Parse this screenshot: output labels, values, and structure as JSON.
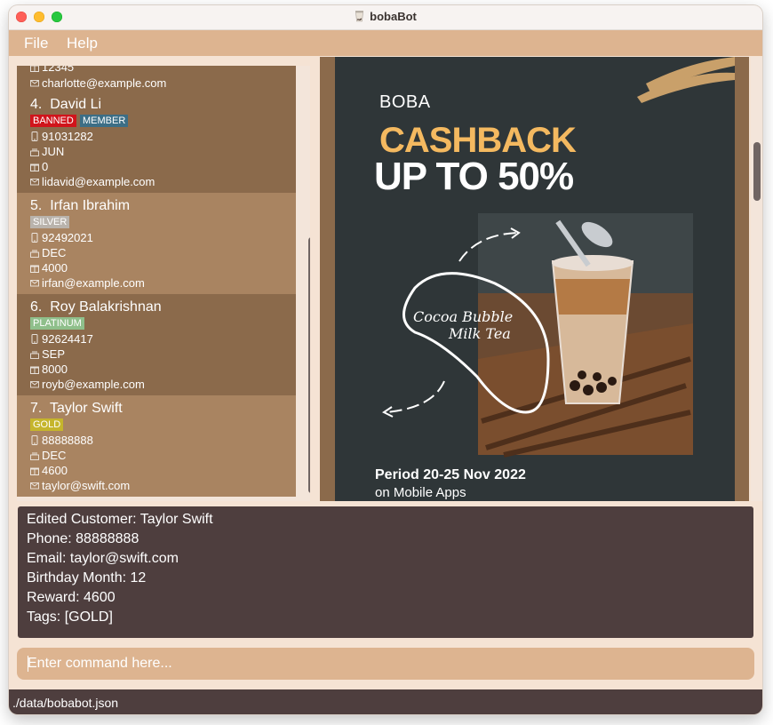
{
  "window": {
    "title": "bobaBot"
  },
  "menu": {
    "file": "File",
    "help": "Help"
  },
  "customers": [
    {
      "index": "",
      "name": "",
      "tags": [],
      "phone": "12345",
      "birthday": "",
      "reward": "",
      "email": "charlotte@example.com"
    },
    {
      "index": "4.",
      "name": "David Li",
      "tags": [
        {
          "label": "BANNED",
          "color": "#d0141b"
        },
        {
          "label": "MEMBER",
          "color": "#3c6e86"
        }
      ],
      "phone": "91031282",
      "birthday": "JUN",
      "reward": "0",
      "email": "lidavid@example.com"
    },
    {
      "index": "5.",
      "name": "Irfan Ibrahim",
      "tags": [
        {
          "label": "SILVER",
          "color": "#b9b3ac"
        }
      ],
      "phone": "92492021",
      "birthday": "DEC",
      "reward": "4000",
      "email": "irfan@example.com"
    },
    {
      "index": "6.",
      "name": "Roy Balakrishnan",
      "tags": [
        {
          "label": "PLATINUM",
          "color": "#8fbf8b"
        }
      ],
      "phone": "92624417",
      "birthday": "SEP",
      "reward": "8000",
      "email": "royb@example.com"
    },
    {
      "index": "7.",
      "name": "Taylor Swift",
      "tags": [
        {
          "label": "GOLD",
          "color": "#c5b52c"
        }
      ],
      "phone": "88888888",
      "birthday": "DEC",
      "reward": "4600",
      "email": "taylor@swift.com"
    }
  ],
  "poster": {
    "brand": "BOBA",
    "headline": "CASHBACK",
    "subheadline": "UP TO 50%",
    "product_line1": "Cocoa Bubble",
    "product_line2": "Milk Tea",
    "period": "Period 20-25 Nov 2022",
    "channel": "on Mobile Apps"
  },
  "result": {
    "lines": [
      "Edited Customer: Taylor Swift",
      "Phone: 88888888",
      "Email: taylor@swift.com",
      "Birthday Month: 12",
      "Reward: 4600",
      "Tags: [GOLD]"
    ]
  },
  "command": {
    "placeholder": "Enter command here..."
  },
  "status": {
    "path": "./data/bobabot.json"
  }
}
